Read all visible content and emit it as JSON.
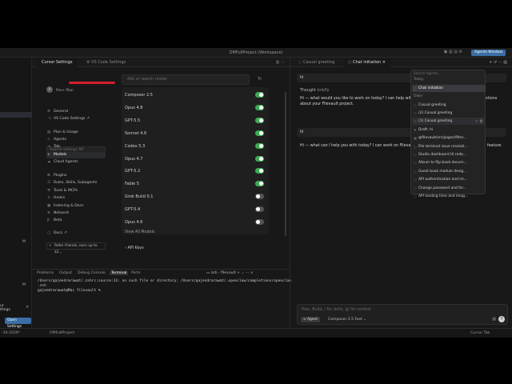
{
  "window": {
    "title": "OMFullProject (Workspace)",
    "agents_button": "Agents Window"
  },
  "left_edge": {
    "open_settings_label": "Open Settings",
    "left_peek_lines": [
      "ur",
      "ttings"
    ]
  },
  "tabs": [
    {
      "label": "Cursor Settings",
      "active": true
    },
    {
      "label": "VS Code Settings",
      "active": false
    }
  ],
  "account": {
    "avatar_letter": "A",
    "plan": "Pro+ Plan"
  },
  "settings_search_placeholder": "Search settings ⌘F",
  "nav": [
    {
      "icon": "gear-icon",
      "glyph": "⚙",
      "label": "General"
    },
    {
      "icon": "code-icon",
      "glyph": "⌥",
      "label": "VS Code Settings ↗"
    },
    {
      "icon": "receipt-icon",
      "glyph": "▤",
      "label": "Plan & Usage"
    },
    {
      "icon": "agents-icon",
      "glyph": "∞",
      "label": "Agents"
    },
    {
      "icon": "tab-icon",
      "glyph": "⇥",
      "label": "Tab"
    },
    {
      "icon": "models-icon",
      "glyph": "◈",
      "label": "Models"
    },
    {
      "icon": "cloud-icon",
      "glyph": "☁",
      "label": "Cloud Agents"
    },
    {
      "icon": "plugins-icon",
      "glyph": "⊞",
      "label": "Plugins"
    },
    {
      "icon": "rules-icon",
      "glyph": "☰",
      "label": "Rules, Skills, Subagents"
    },
    {
      "icon": "tools-icon",
      "glyph": "⚒",
      "label": "Tools & MCPs"
    },
    {
      "icon": "hooks-icon",
      "glyph": "⚓",
      "label": "Hooks"
    },
    {
      "icon": "indexing-icon",
      "glyph": "▦",
      "label": "Indexing & Docs"
    },
    {
      "icon": "network-icon",
      "glyph": "⊕",
      "label": "Network"
    },
    {
      "icon": "beta-icon",
      "glyph": "β",
      "label": "Beta"
    },
    {
      "icon": "docs-icon",
      "glyph": "▢",
      "label": "Docs ↗"
    }
  ],
  "refer_label": "Refer friends, earn up to $2...",
  "models_panel": {
    "search_placeholder": "Add or search model",
    "models": [
      {
        "name": "Composer 2.5",
        "enabled": true
      },
      {
        "name": "Opus 4.8",
        "enabled": true
      },
      {
        "name": "GPT-5.5",
        "enabled": true
      },
      {
        "name": "Sonnet 4.6",
        "enabled": true
      },
      {
        "name": "Codex 5.3",
        "enabled": true
      },
      {
        "name": "Opus 4.7",
        "enabled": true
      },
      {
        "name": "GPT-5.2",
        "enabled": true
      },
      {
        "name": "Fable 5",
        "enabled": true
      },
      {
        "name": "Grok Build 0.1",
        "enabled": false
      },
      {
        "name": "GPT-5.4",
        "enabled": false
      },
      {
        "name": "Opus 4.6",
        "enabled": false
      }
    ],
    "view_all": "View All Models",
    "api_keys": "› API Keys"
  },
  "terminal": {
    "tabs": [
      "Problems",
      "Output",
      "Debug Console",
      "Terminal",
      "Ports"
    ],
    "active_tab": "Terminal",
    "shell_label": "zsh - filevault",
    "lines": [
      "/Users/gajendrarawat/.zshrc:source:31: no such file or directory: /Users/gajendrarawat/.openclaw/completions/openclaw",
      ".zsh",
      "gajendrarawat@Mac filevault %"
    ]
  },
  "statusbar": {
    "left": "-30-2026*",
    "project": "OMFullProject",
    "right": "Cursor Tab"
  },
  "chat_tabs": [
    {
      "label": "Casual greeting",
      "active": false
    },
    {
      "label": "Chat initiation",
      "active": true
    }
  ],
  "chat": {
    "msg1": "hi",
    "thought_label": "Thought",
    "thought_detail": "briefly",
    "reply1_line1": "Hi — what would you like to work on today? I can help with p",
    "reply1_line1_tail": "stions",
    "reply1_line2": "about your Filevault project.",
    "msg2": "hi",
    "reply2": "Hi — what can I help you with today? I can work on Filevault,",
    "reply2_tail": "feature."
  },
  "composer": {
    "placeholder": "Plan, Build, / for skills, @ for context",
    "mode": "∞ Agent",
    "model": "Composer 2.5 Fast ⌄"
  },
  "history_dropdown": {
    "search_placeholder": "Search Agents...",
    "today_label": "Today",
    "today": [
      {
        "label": "Chat initiation"
      }
    ],
    "older_label": "Older",
    "older": [
      {
        "label": "Casual greeting"
      },
      {
        "label": "(2) Casual greeting"
      },
      {
        "label": "(1) Casual greeting",
        "meta": "✎ 🗑"
      },
      {
        "label": "Draft: hi"
      },
      {
        "label": "@filevault/src/pages/filter..."
      },
      {
        "label": "File terminal issue resoluti..."
      },
      {
        "label": "Studio dashboard UI rede..."
      },
      {
        "label": "Album to flip book docum..."
      },
      {
        "label": "Guest book module desig..."
      },
      {
        "label": "API authentication and im..."
      },
      {
        "label": "Change password and for..."
      },
      {
        "label": "API loading time and imag..."
      }
    ]
  }
}
